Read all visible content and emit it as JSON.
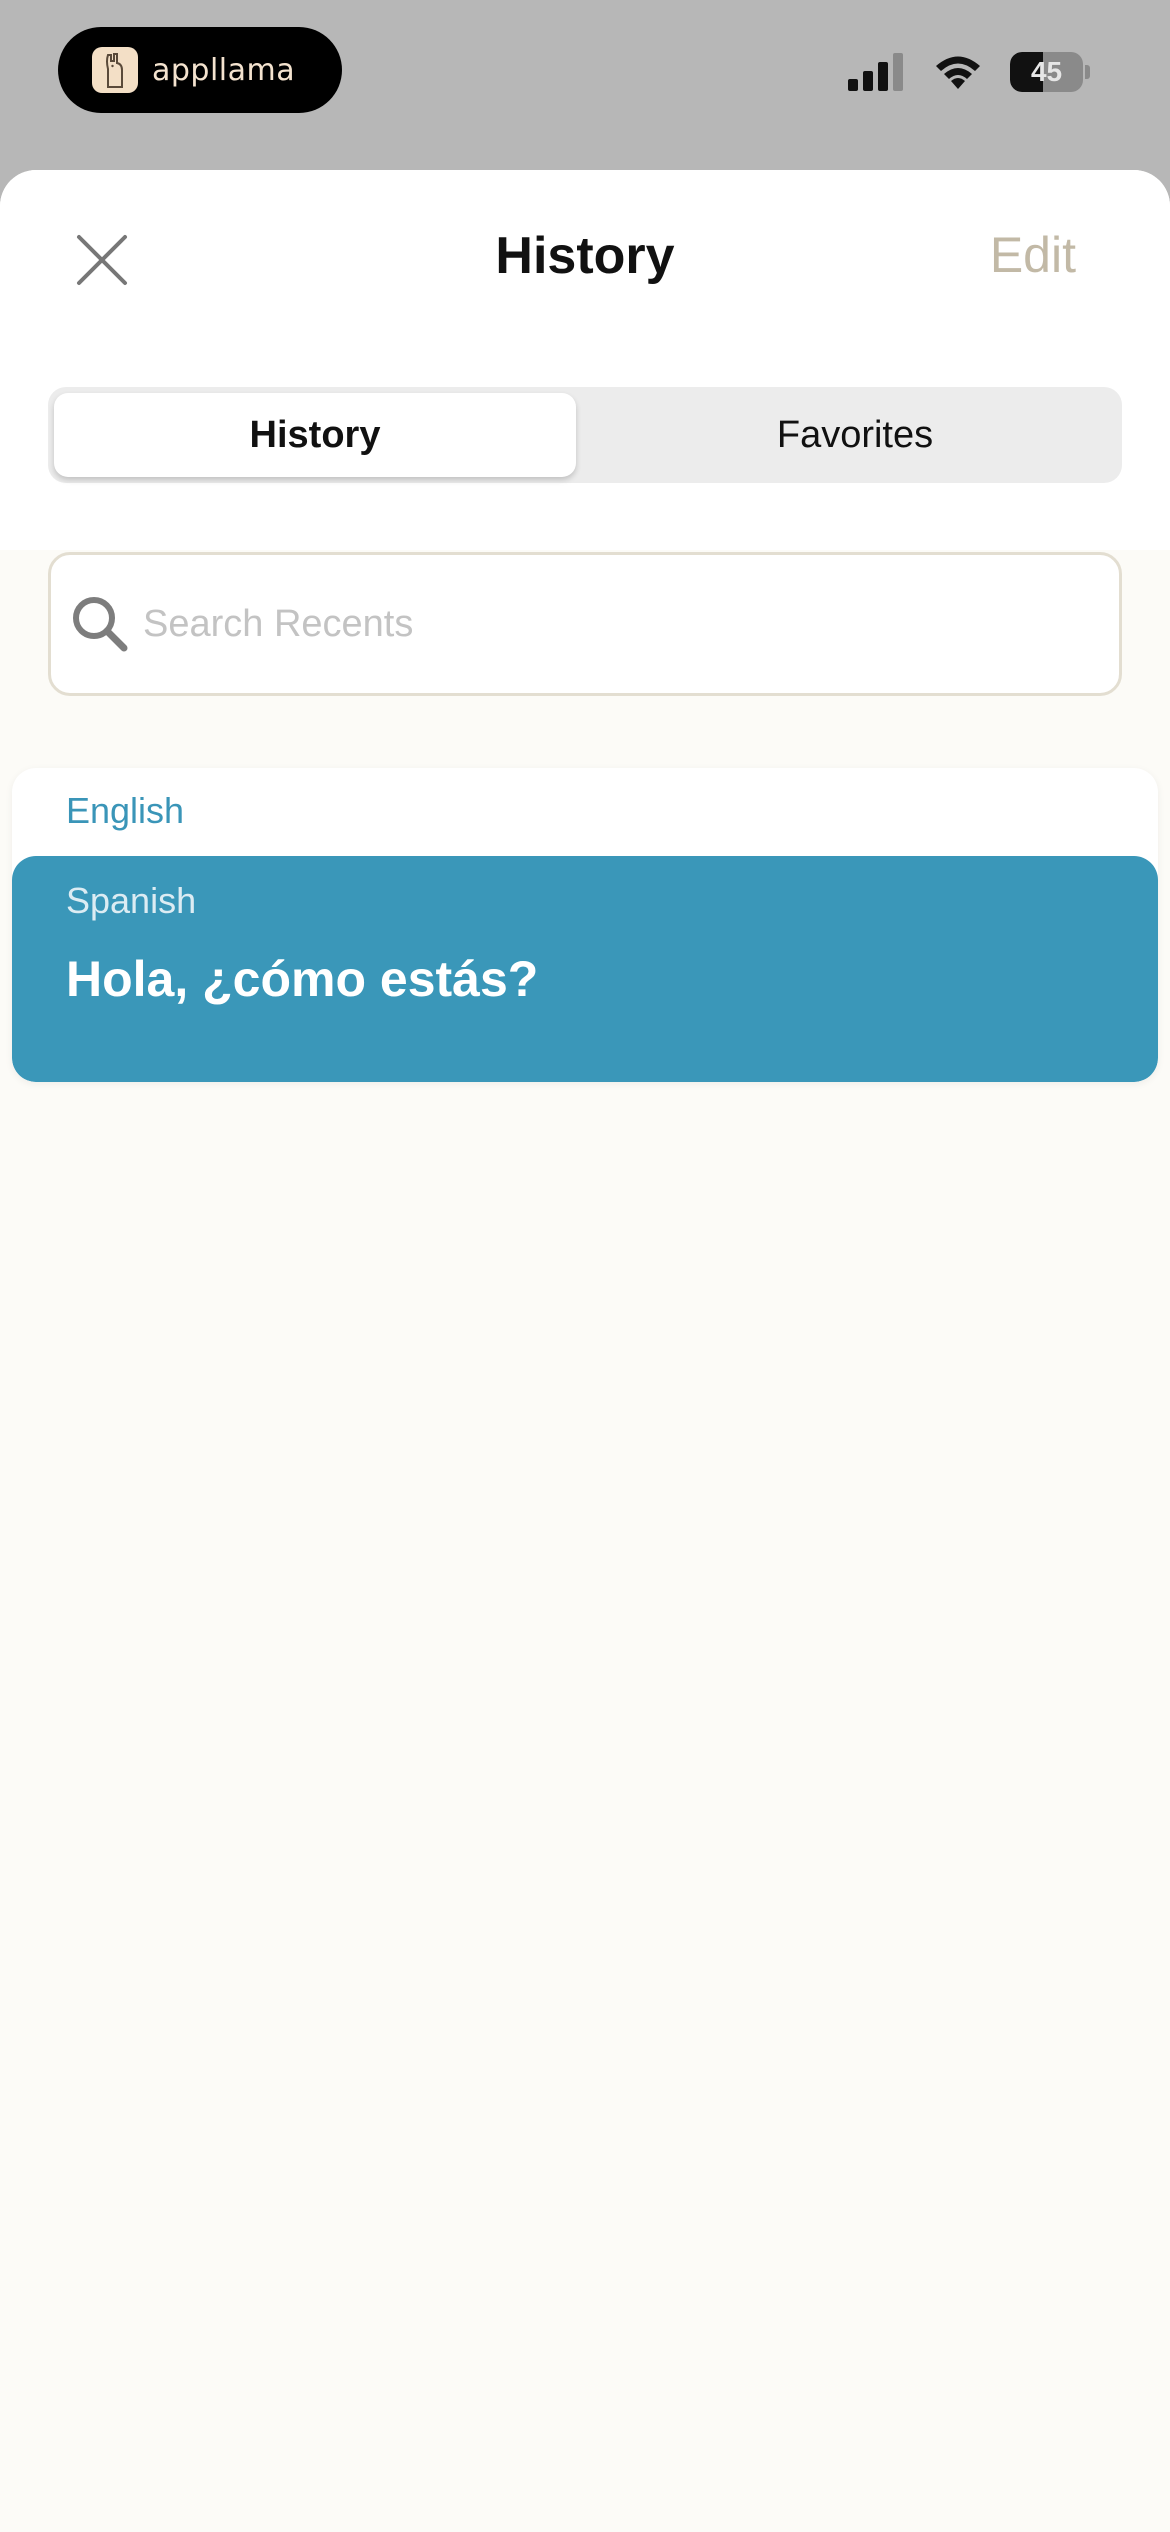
{
  "status_bar": {
    "app_pill_label": "appllama",
    "battery_level": "45",
    "battery_percent": 45,
    "icons": [
      "signal-icon",
      "wifi-icon",
      "battery-icon"
    ]
  },
  "header": {
    "title": "History",
    "edit_label": "Edit",
    "close_icon": "close-icon"
  },
  "tabs": [
    {
      "label": "History",
      "selected": true
    },
    {
      "label": "Favorites",
      "selected": false
    }
  ],
  "search": {
    "placeholder": "Search Recents",
    "value": "",
    "icon": "search-icon"
  },
  "history": [
    {
      "source_language": "English",
      "target_language": "Spanish",
      "translation": "Hola, ¿cómo estás?"
    }
  ],
  "colors": {
    "accent": "#3a97b9",
    "edit_text": "#c2b9a6",
    "background": "#fcfbf7",
    "status_bar": "#b7b7b7"
  }
}
